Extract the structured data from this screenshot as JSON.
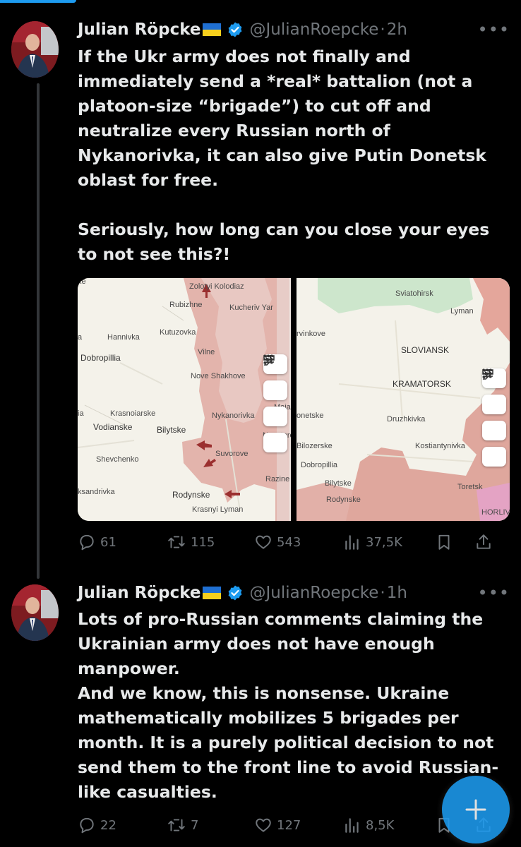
{
  "tweets": [
    {
      "author_name": "Julian Röpcke",
      "handle": "@JulianRoepcke",
      "separator": "·",
      "time": "2h",
      "text": "If the Ukr army does not finally and immediately send a *real* battalion (not a platoon-size “brigade”) to cut off and neutralize every Russian north of Nykanorivka, it can also give Putin Donetsk oblast for free.\n\nSeriously, how long can you close your eyes to not see this?!",
      "replies": "61",
      "reposts": "115",
      "likes": "543",
      "views": "37,5K"
    },
    {
      "author_name": "Julian Röpcke",
      "handle": "@JulianRoepcke",
      "separator": "·",
      "time": "1h",
      "text": "Lots of pro-Russian comments claiming the Ukrainian army does not have enough manpower.\nAnd we know, this is nonsense. Ukraine mathematically mobilizes 5 brigades per month. It is a purely political decision to not send them to the front line to avoid Russian-like casualties.",
      "replies": "22",
      "reposts": "7",
      "likes": "127",
      "views": "8,5K"
    }
  ],
  "maps": {
    "left": {
      "labels": [
        "Zolotyi Kolodiaz",
        "Rubizhne",
        "Kucheriv Yar",
        "Hannivka",
        "Kutuzovka",
        "Dobropillia",
        "Vilne",
        "Nove Shakhove",
        "Krasnoiarske",
        "Nykanorivka",
        "Maiak",
        "Vodianske",
        "Bilytske",
        "Novotore",
        "Shevchenko",
        "Suvorove",
        "Razine",
        "ksandrivka",
        "Rodynske",
        "Krasnyi Lyman",
        "ke",
        "ia",
        "a"
      ]
    },
    "right": {
      "labels": [
        "Sviatohirsk",
        "Lyman",
        "rvinkove",
        "SLOVIANSK",
        "KRAMATORSK",
        "Druzhkivka",
        "onetske",
        "Bilozerske",
        "Kostiantynivka",
        "Dobropillia",
        "Bilytske",
        "Toretsk",
        "Rodynske",
        "HORLIV"
      ]
    }
  },
  "colors": {
    "background": "#000000",
    "accent": "#1d9bf0",
    "muted": "#71767b",
    "text": "#e7e9ea",
    "occupied": "#dba79d",
    "frontline_arrow": "#b23a3a"
  },
  "icons": [
    "verified-badge-icon",
    "more-icon",
    "reply-icon",
    "repost-icon",
    "like-icon",
    "views-icon",
    "bookmark-icon",
    "share-icon",
    "plus-icon",
    "filter-icon",
    "ruler-icon",
    "draw-icon",
    "grid-icon"
  ]
}
